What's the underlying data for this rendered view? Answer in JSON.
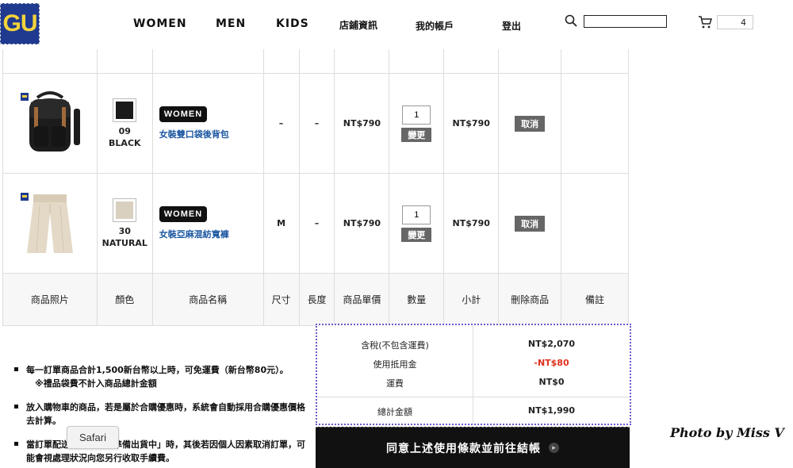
{
  "header": {
    "logo_text": "GU",
    "nav": [
      "WOMEN",
      "MEN",
      "KIDS",
      "店鋪資訊",
      "我的帳戶",
      "登出"
    ],
    "search": {
      "value": "",
      "icon": "search-icon"
    },
    "cart": {
      "count": "4",
      "icon": "cart-icon"
    }
  },
  "table": {
    "headers": [
      "商品照片",
      "顏色",
      "商品名稱",
      "尺寸",
      "長度",
      "商品單價",
      "數量",
      "小計",
      "刪除商品",
      "備註"
    ],
    "rows": [
      {
        "color_code": "09",
        "color_name": "BLACK",
        "swatch": "#1a1a1a",
        "badge": "WOMEN",
        "name": "女裝雙口袋後背包",
        "size": "–",
        "length": "–",
        "price": "NT$790",
        "qty": "1",
        "change_label": "變更",
        "subtotal": "NT$790",
        "cancel_label": "取消"
      },
      {
        "color_code": "30",
        "color_name": "NATURAL",
        "swatch": "#d9d0c0",
        "badge": "WOMEN",
        "name": "女裝亞麻混紡寬褲",
        "size": "M",
        "length": "–",
        "price": "NT$790",
        "qty": "1",
        "change_label": "變更",
        "subtotal": "NT$790",
        "cancel_label": "取消"
      }
    ]
  },
  "notes": {
    "n1_line1": "每一訂單商品合計1,500新台幣以上時，可免運費（新台幣80元）。",
    "n1_line2": "※禮品袋費不計入商品總計金額",
    "n2": "放入購物車的商品，若是屬於合購優惠時，系統會自動採用合購優惠價格去計算。",
    "n3": "當訂單配送狀況顯示「準備出貨中」時，其後若因個人因素取消訂單，可能會視處理狀況向您另行收取手續費。"
  },
  "summary": {
    "tax_label": "含稅(不包含運費)",
    "tax_value": "NT$2,070",
    "credit_label": "使用抵用金",
    "credit_value": "-NT$80",
    "shipping_label": "運費",
    "shipping_value": "NT$0",
    "total_label": "總計金額",
    "total_value": "NT$1,990"
  },
  "checkout_label": "同意上述使用條款並前往結帳",
  "safari_tooltip": "Safari",
  "watermark": "Photo by Miss V",
  "colors": {
    "brand_blue": "#1f3a8f",
    "brand_yellow": "#f5d33a",
    "discount_red": "#e0301e",
    "link_blue": "#1a56a0"
  }
}
